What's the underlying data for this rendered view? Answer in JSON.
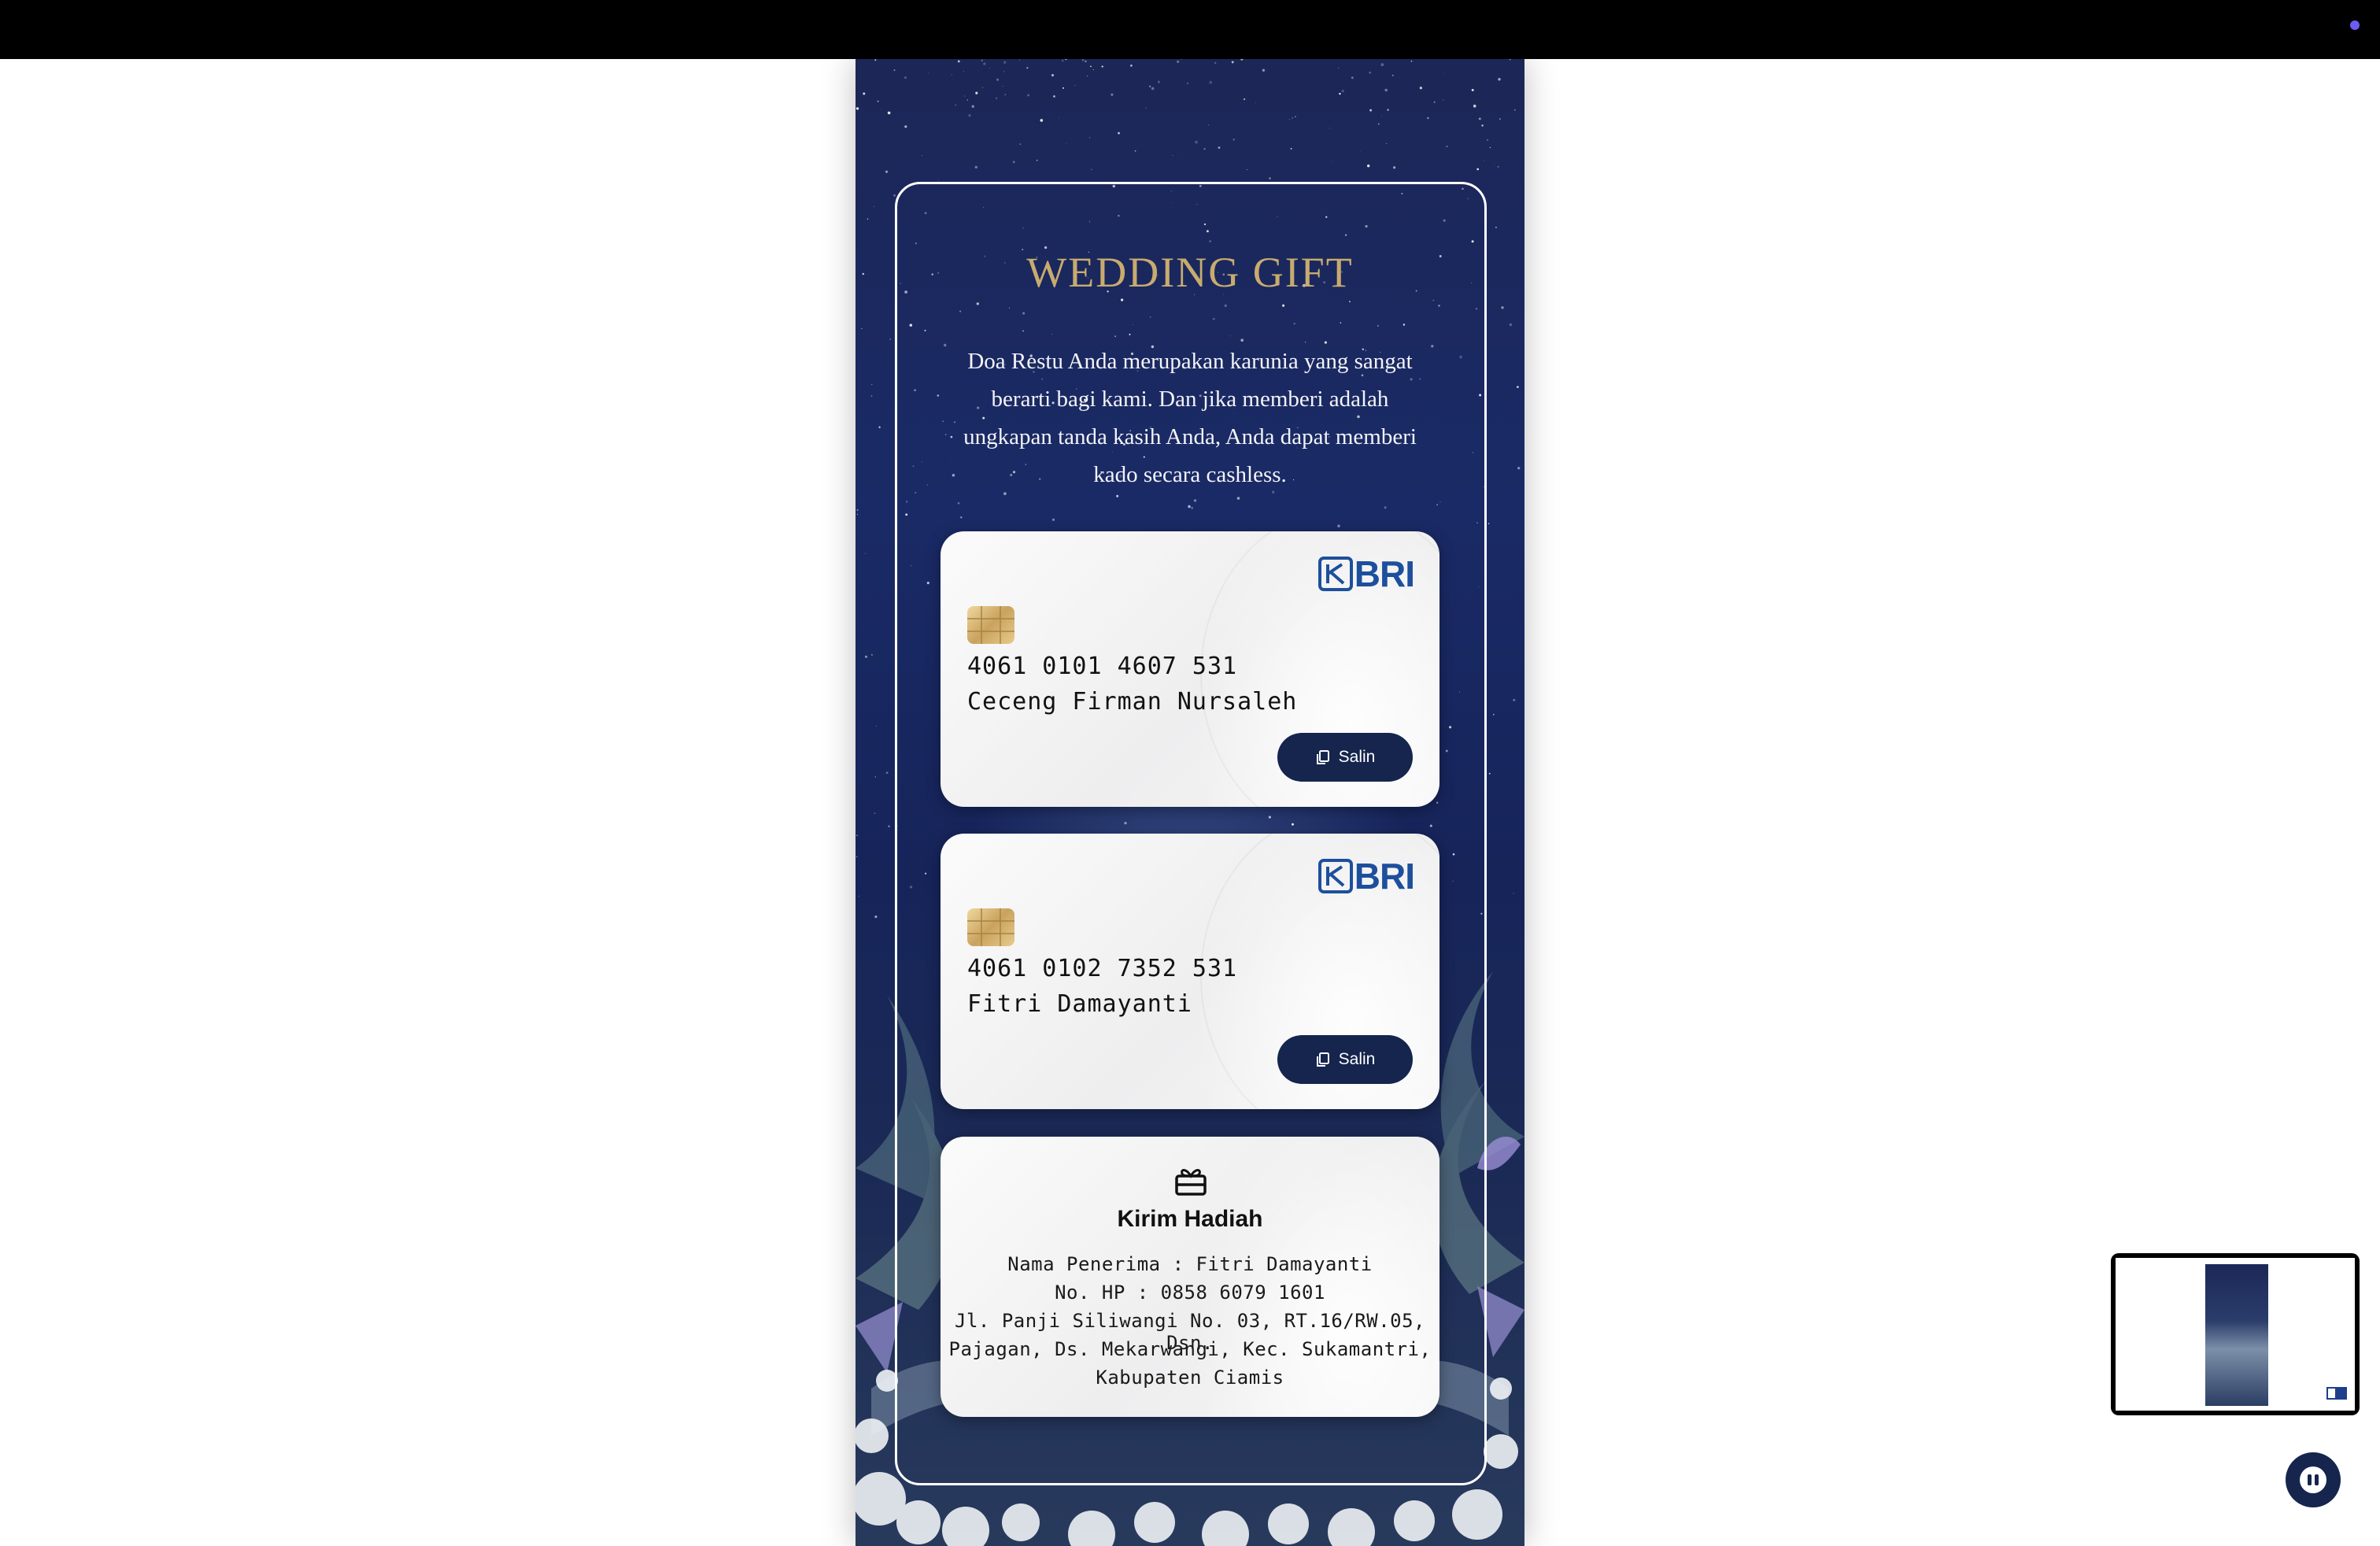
{
  "section": {
    "title": "WEDDING GIFT",
    "intro": "Doa Restu Anda merupakan karunia yang sangat berarti bagi kami. Dan jika memberi adalah ungkapan tanda kasih Anda, Anda dapat memberi kado secara cashless."
  },
  "accounts": [
    {
      "bank": "BRI",
      "number": "4061 0101 4607 531",
      "holder": "Ceceng Firman Nursaleh",
      "copy_label": "Salin"
    },
    {
      "bank": "BRI",
      "number": "4061 0102 7352 531",
      "holder": "Fitri Damayanti",
      "copy_label": "Salin"
    }
  ],
  "gift": {
    "title": "Kirim Hadiah",
    "recipient": "Nama Penerima : Fitri Damayanti",
    "phone": "No. HP : 0858 6079 1601",
    "address_1": "Jl. Panji Siliwangi No. 03, RT.16/RW.05, Dsn.",
    "address_2": "Pajagan, Ds. Mekarwangi, Kec. Sukamantri,",
    "address_3": "Kabupaten Ciamis"
  },
  "colors": {
    "title_gold": "#c8ab6e",
    "button_navy": "#15254d",
    "bri_blue": "#1d4f9c",
    "accent_purple": "#6d5cf0"
  },
  "icons": {
    "copy": "copy-icon",
    "gift": "gift-icon",
    "chip": "card-chip-icon",
    "music": "pause-icon"
  }
}
